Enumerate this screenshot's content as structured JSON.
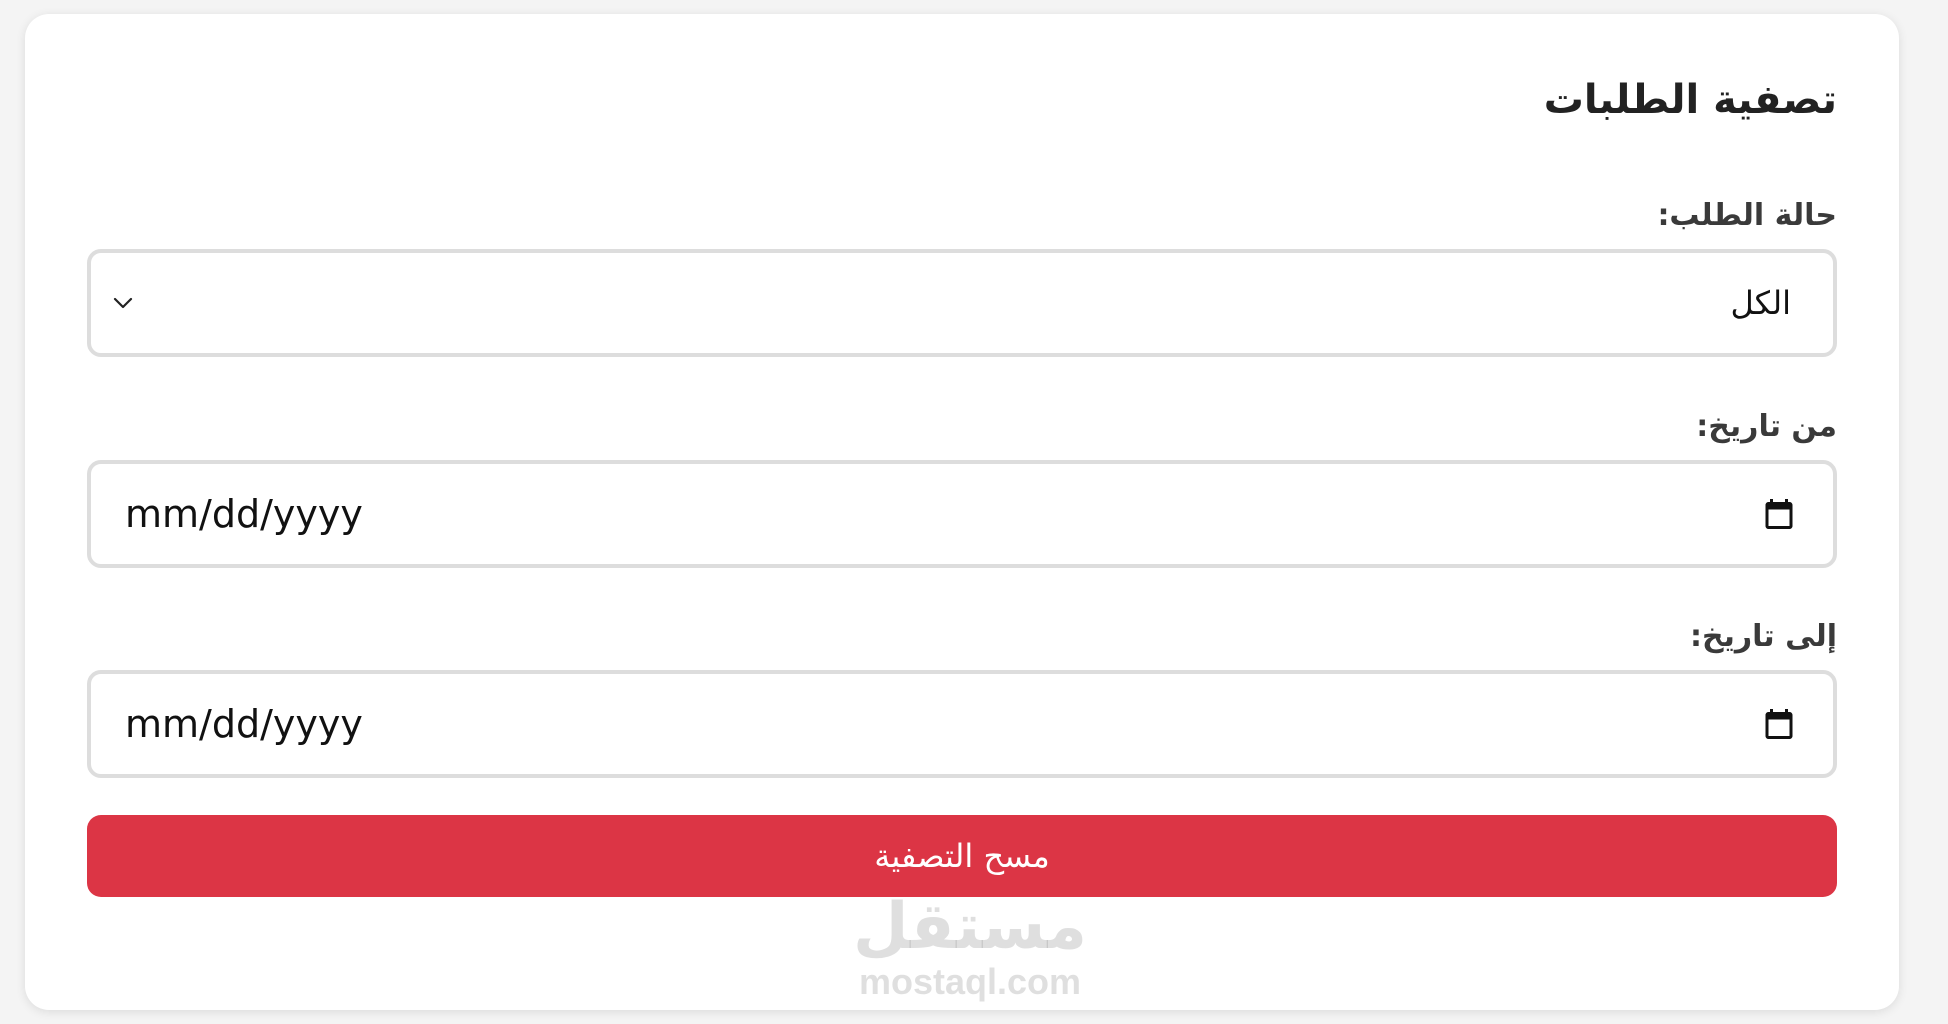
{
  "form": {
    "title": "تصفية الطلبات",
    "status_label": "حالة الطلب:",
    "status_selected": "الكل",
    "from_label": "من تاريخ:",
    "from_value": "mm/dd/yyyy",
    "to_label": "إلى تاريخ:",
    "to_value": "mm/dd/yyyy",
    "clear_button": "مسح التصفية"
  },
  "watermark": {
    "arabic": "مستقل",
    "latin": "mostaql.com"
  },
  "icons": {
    "dropdown": "chevron-down-icon",
    "date": "calendar-icon"
  },
  "colors": {
    "danger": "#dc3545",
    "border": "#dddddd"
  }
}
